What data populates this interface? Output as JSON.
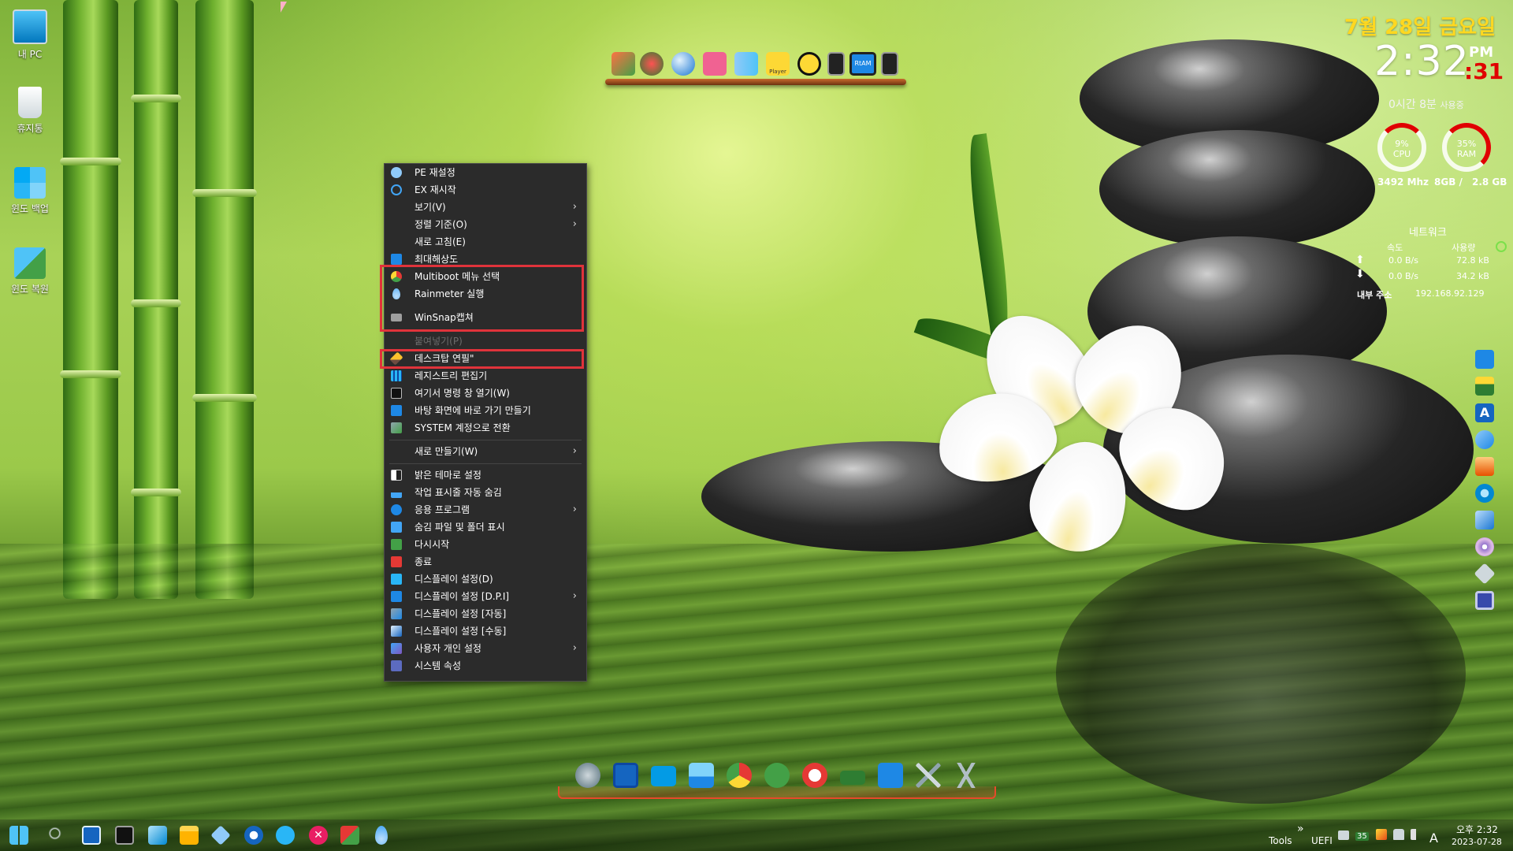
{
  "desktop_icons": [
    {
      "label": "내 PC",
      "icon": "monitor-icon"
    },
    {
      "label": "휴지통",
      "icon": "recycle-bin-icon"
    },
    {
      "label": "윈도 백업",
      "icon": "backup-icon"
    },
    {
      "label": "윈도 복원",
      "icon": "restore-icon"
    }
  ],
  "top_dock": {
    "icons": [
      "install-icon",
      "partition-icon",
      "search-tool-icon",
      "windows-icon",
      "book-icon",
      "player-icon",
      "aimp-icon",
      "speaker-left-icon",
      "monitor-icon",
      "speaker-right-icon"
    ],
    "player_label": "Player",
    "monitor_label": "RtAM"
  },
  "widget": {
    "date": "7월 28일 금요일",
    "time": "2:32",
    "ampm": "PM",
    "seconds": ":31",
    "uptime": "0시간 8분",
    "uptime_suffix": "사용중",
    "cpu": {
      "label": "CPU",
      "percent": "9%",
      "value": 9,
      "freq": "3492 Mhz"
    },
    "ram": {
      "label": "RAM",
      "percent": "35%",
      "value": 35,
      "total": "8GB /",
      "used": "2.8 GB"
    },
    "network": {
      "title": "네트워크",
      "speed_header": "속도",
      "usage_header": "사용량",
      "up_speed": "0.0 B/s",
      "up_usage": "72.8 kB",
      "down_speed": "0.0 B/s",
      "down_usage": "34.2 kB",
      "internal_label": "내부 주소",
      "internal_ip": "192.168.92.129"
    }
  },
  "context_menu": {
    "items": [
      {
        "label": "PE 재설정",
        "icon": "refresh-icon",
        "submenu": false,
        "disabled": false
      },
      {
        "label": "EX 재시작",
        "icon": "restart-icon",
        "submenu": false,
        "disabled": false
      },
      {
        "label": "보기(V)",
        "icon": "",
        "submenu": true,
        "disabled": false
      },
      {
        "label": "정렬 기준(O)",
        "icon": "",
        "submenu": true,
        "disabled": false
      },
      {
        "label": "새로 고침(E)",
        "icon": "",
        "submenu": false,
        "disabled": false
      },
      {
        "label": "최대해상도",
        "icon": "display-icon",
        "submenu": false,
        "disabled": false
      },
      {
        "label": "Multiboot 메뉴 선택",
        "icon": "multiboot-icon",
        "submenu": false,
        "disabled": false
      },
      {
        "label": "Rainmeter 실행",
        "icon": "rainmeter-icon",
        "submenu": false,
        "disabled": false
      },
      {
        "label": "WinSnap캡쳐",
        "icon": "camera-icon",
        "submenu": false,
        "disabled": false
      },
      {
        "label": "붙여넣기(P)",
        "icon": "",
        "submenu": false,
        "disabled": true
      },
      {
        "label": "데스크탑 연필\"",
        "icon": "pencil-icon",
        "submenu": false,
        "disabled": false
      },
      {
        "label": "레지스트리 편집기",
        "icon": "registry-icon",
        "submenu": false,
        "disabled": false
      },
      {
        "label": "여기서 명령 창 열기(W)",
        "icon": "cmd-icon",
        "submenu": false,
        "disabled": false
      },
      {
        "label": "바탕 화면에 바로 가기 만들기",
        "icon": "shortcut-icon",
        "submenu": false,
        "disabled": false
      },
      {
        "label": "SYSTEM 계정으로 전환",
        "icon": "user-switch-icon",
        "submenu": false,
        "disabled": false
      },
      {
        "label": "새로 만들기(W)",
        "icon": "",
        "submenu": true,
        "disabled": false
      },
      {
        "label": "밝은 테마로 설정",
        "icon": "theme-icon",
        "submenu": false,
        "disabled": false
      },
      {
        "label": "작업 표시줄 자동 숨김",
        "icon": "taskbar-icon",
        "submenu": false,
        "disabled": false
      },
      {
        "label": "응용 프로그램",
        "icon": "apps-icon",
        "submenu": true,
        "disabled": false
      },
      {
        "label": "숨김 파일 및 폴더 표시",
        "icon": "hidden-files-icon",
        "submenu": false,
        "disabled": false
      },
      {
        "label": "다시시작",
        "icon": "reboot-icon",
        "submenu": false,
        "disabled": false
      },
      {
        "label": "종료",
        "icon": "power-icon",
        "submenu": false,
        "disabled": false
      },
      {
        "label": "디스플레이 설정(D)",
        "icon": "display-settings-icon",
        "submenu": false,
        "disabled": false
      },
      {
        "label": "디스플레이 설정 [D.P.I]",
        "icon": "dpi-icon",
        "submenu": true,
        "disabled": false
      },
      {
        "label": "디스플레이 설정 [자동]",
        "icon": "display-auto-icon",
        "submenu": false,
        "disabled": false
      },
      {
        "label": "디스플레이 설정 [수동]",
        "icon": "display-manual-icon",
        "submenu": false,
        "disabled": false
      },
      {
        "label": "사용자 개인 설정",
        "icon": "personalize-icon",
        "submenu": true,
        "disabled": false
      },
      {
        "label": "시스템 속성",
        "icon": "system-props-icon",
        "submenu": false,
        "disabled": false
      }
    ],
    "arrow": "›"
  },
  "bottom_dock": {
    "icons": [
      "rocket-icon",
      "save-icon",
      "desktop-icon",
      "photo-icon",
      "chrome-icon",
      "utorrent-icon",
      "no-rec-icon",
      "network-card-icon",
      "wrench-icon",
      "tools-icon",
      "compass-icon"
    ]
  },
  "right_toolbar": {
    "icons": [
      "sync-icon",
      "drive-icon",
      "font-icon",
      "bluetooth-search-icon",
      "archive-icon",
      "gears-icon",
      "network-icon",
      "disc-icon",
      "usb-icon",
      "chip-icon"
    ]
  },
  "taskbar": {
    "left_icons": [
      "start-icon",
      "search-icon",
      "task-manager-icon",
      "cmd-icon",
      "notepad-icon",
      "explorer-icon",
      "cube-icon",
      "power-tool-icon",
      "sync-app-icon",
      "close-app-icon",
      "partition-app-icon",
      "rainmeter-tray-icon"
    ],
    "tools_label": "Tools",
    "tools_chevron": "»",
    "uefi_label": "UEFI",
    "badge": "35",
    "time": "오후 2:32",
    "date": "2023-07-28"
  },
  "colors": {
    "menu_bg": "#2b2b2b",
    "highlight": "#e0333b",
    "date_yellow": "#ffd820",
    "seconds_red": "#e00000"
  }
}
